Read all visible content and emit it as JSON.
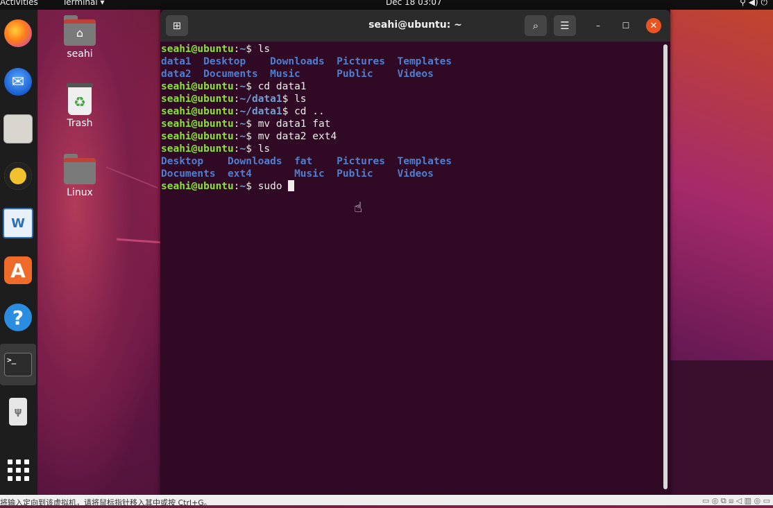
{
  "topbar": {
    "activities": "Activities",
    "app_menu": "Terminal ▾",
    "clock": "Dec 18  03:07",
    "tray": "⚲   ◀)   ⏻"
  },
  "dock": {
    "firefox": "",
    "thunderbird": "✉",
    "writer": "W",
    "software": "A",
    "help": "?",
    "terminal": ">_",
    "usb": "ψ"
  },
  "desktop": {
    "home": {
      "label": "seahi",
      "glyph": "⌂"
    },
    "trash": {
      "label": "Trash",
      "glyph": "♻"
    },
    "linux": {
      "label": "Linux"
    }
  },
  "window": {
    "title": "seahi@ubuntu: ~",
    "new_tab": "⊞",
    "search": "⌕",
    "menu": "☰",
    "minimize": "–",
    "maximize": "☐",
    "close": "✕"
  },
  "terminal": {
    "user": "seahi@ubuntu",
    "lines": [
      {
        "path": "~",
        "cmd": " ls"
      },
      {
        "out": [
          "data1  ",
          "Desktop    ",
          "Downloads  ",
          "Pictures  ",
          "Templates"
        ]
      },
      {
        "out": [
          "data2  ",
          "Documents  ",
          "Music      ",
          "Public    ",
          "Videos"
        ]
      },
      {
        "path": "~",
        "cmd": " cd data1"
      },
      {
        "path": "~/data1",
        "cmd": " ls"
      },
      {
        "path": "~/data1",
        "cmd": " cd .."
      },
      {
        "path": "~",
        "cmd": " mv data1 fat"
      },
      {
        "path": "~",
        "cmd": " mv data2 ext4"
      },
      {
        "path": "~",
        "cmd": " ls"
      },
      {
        "out": [
          "Desktop    ",
          "Downloads  ",
          "fat    ",
          "Pictures  ",
          "Templates"
        ]
      },
      {
        "out": [
          "Documents  ",
          "ext4       ",
          "Music  ",
          "Public    ",
          "Videos"
        ]
      },
      {
        "path": "~",
        "cmd": " sudo "
      }
    ]
  },
  "bottombar": {
    "hint": "将输入定向到该虚拟机，请将鼠标指针移入其中或按 Ctrl+G。",
    "icons": "▭ ◎ ⧉ ⧈ ◁ ▥ ◎ ▭"
  }
}
